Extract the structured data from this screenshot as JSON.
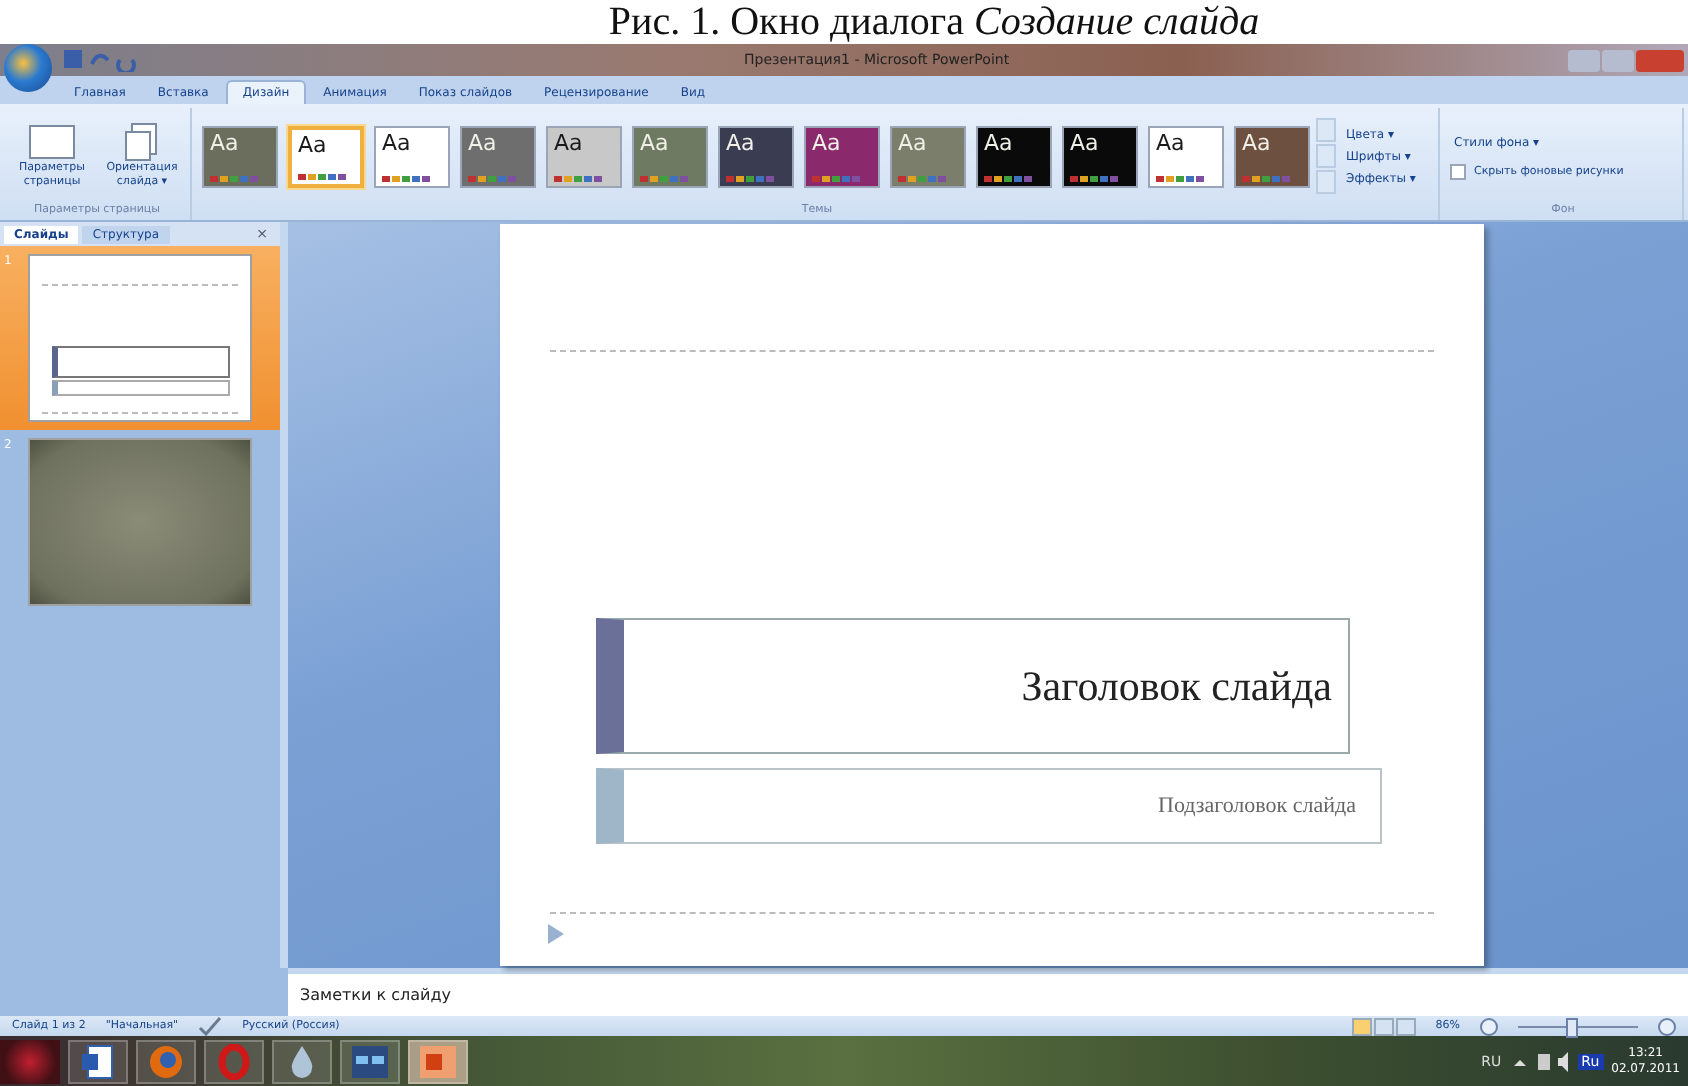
{
  "caption": {
    "text": "Рис. 1. Окно диалога ",
    "emphasis": "Создание слайда"
  },
  "window": {
    "title": "Презентация1 - Microsoft PowerPoint"
  },
  "ribbon_tabs": [
    {
      "label": "Главная",
      "selected": false
    },
    {
      "label": "Вставка",
      "selected": false
    },
    {
      "label": "Дизайн",
      "selected": true
    },
    {
      "label": "Анимация",
      "selected": false
    },
    {
      "label": "Показ слайдов",
      "selected": false
    },
    {
      "label": "Рецензирование",
      "selected": false
    },
    {
      "label": "Вид",
      "selected": false
    }
  ],
  "page_setup": {
    "buttons": [
      "Параметры страницы",
      "Ориентация слайда ▾"
    ],
    "group_label": "Параметры страницы"
  },
  "themes": {
    "group_label": "Темы",
    "items": [
      {
        "label": "Aa",
        "color": "#6b6e5c",
        "selected": false
      },
      {
        "label": "Aa",
        "color": "#ffffff",
        "selected": true
      },
      {
        "label": "Aa",
        "color": "#ffffff",
        "selected": false
      },
      {
        "label": "Aa",
        "color": "#6e6e6e",
        "selected": false
      },
      {
        "label": "Aa",
        "color": "#c8c8c8",
        "selected": false
      },
      {
        "label": "Aa",
        "color": "#6f7a62",
        "selected": false
      },
      {
        "label": "Aa",
        "color": "#3a3d52",
        "selected": false
      },
      {
        "label": "Aa",
        "color": "#8a2a6c",
        "selected": false
      },
      {
        "label": "Aa",
        "color": "#7c7e6c",
        "selected": false
      },
      {
        "label": "Aa",
        "color": "#0a0a0a",
        "selected": false
      },
      {
        "label": "Aa",
        "color": "#0a0a0a",
        "selected": false
      },
      {
        "label": "Aa",
        "color": "#ffffff",
        "selected": false
      },
      {
        "label": "Aa",
        "color": "#6e5040",
        "selected": false
      }
    ]
  },
  "theme_options": [
    "Цвета ▾",
    "Шрифты ▾",
    "Эффекты ▾"
  ],
  "background": {
    "styles_button": "Стили фона ▾",
    "hide_graphics": {
      "label": "Скрыть фоновые рисунки",
      "checked": false
    },
    "group_label": "Фон"
  },
  "pane_tabs": [
    {
      "label": "Слайды",
      "selected": true
    },
    {
      "label": "Структура",
      "selected": false
    }
  ],
  "pane_close": "×",
  "slides": [
    {
      "number": "1",
      "kind": "title",
      "selected": true
    },
    {
      "number": "2",
      "kind": "texture",
      "selected": false
    }
  ],
  "slide": {
    "title": "Заголовок слайда",
    "subtitle": "Подзаголовок слайда"
  },
  "notes": {
    "placeholder": "Заметки к слайду"
  },
  "status_bar": {
    "slide": "Слайд 1 из 2",
    "theme": "\"Начальная\"",
    "language": "Русский (Россия)",
    "zoom": "86%",
    "zoom_slider": {
      "level": 0.43
    }
  },
  "taskbar": {
    "apps": [
      {
        "kind": "document",
        "selected": false
      },
      {
        "kind": "ball",
        "selected": false
      },
      {
        "kind": "ring",
        "selected": false
      },
      {
        "kind": "drop",
        "selected": false
      },
      {
        "kind": "window",
        "selected": false
      },
      {
        "kind": "slides",
        "selected": true
      }
    ],
    "lang": "RU",
    "layout": "Ru",
    "time": "13:21",
    "date": "02.07.2011"
  }
}
